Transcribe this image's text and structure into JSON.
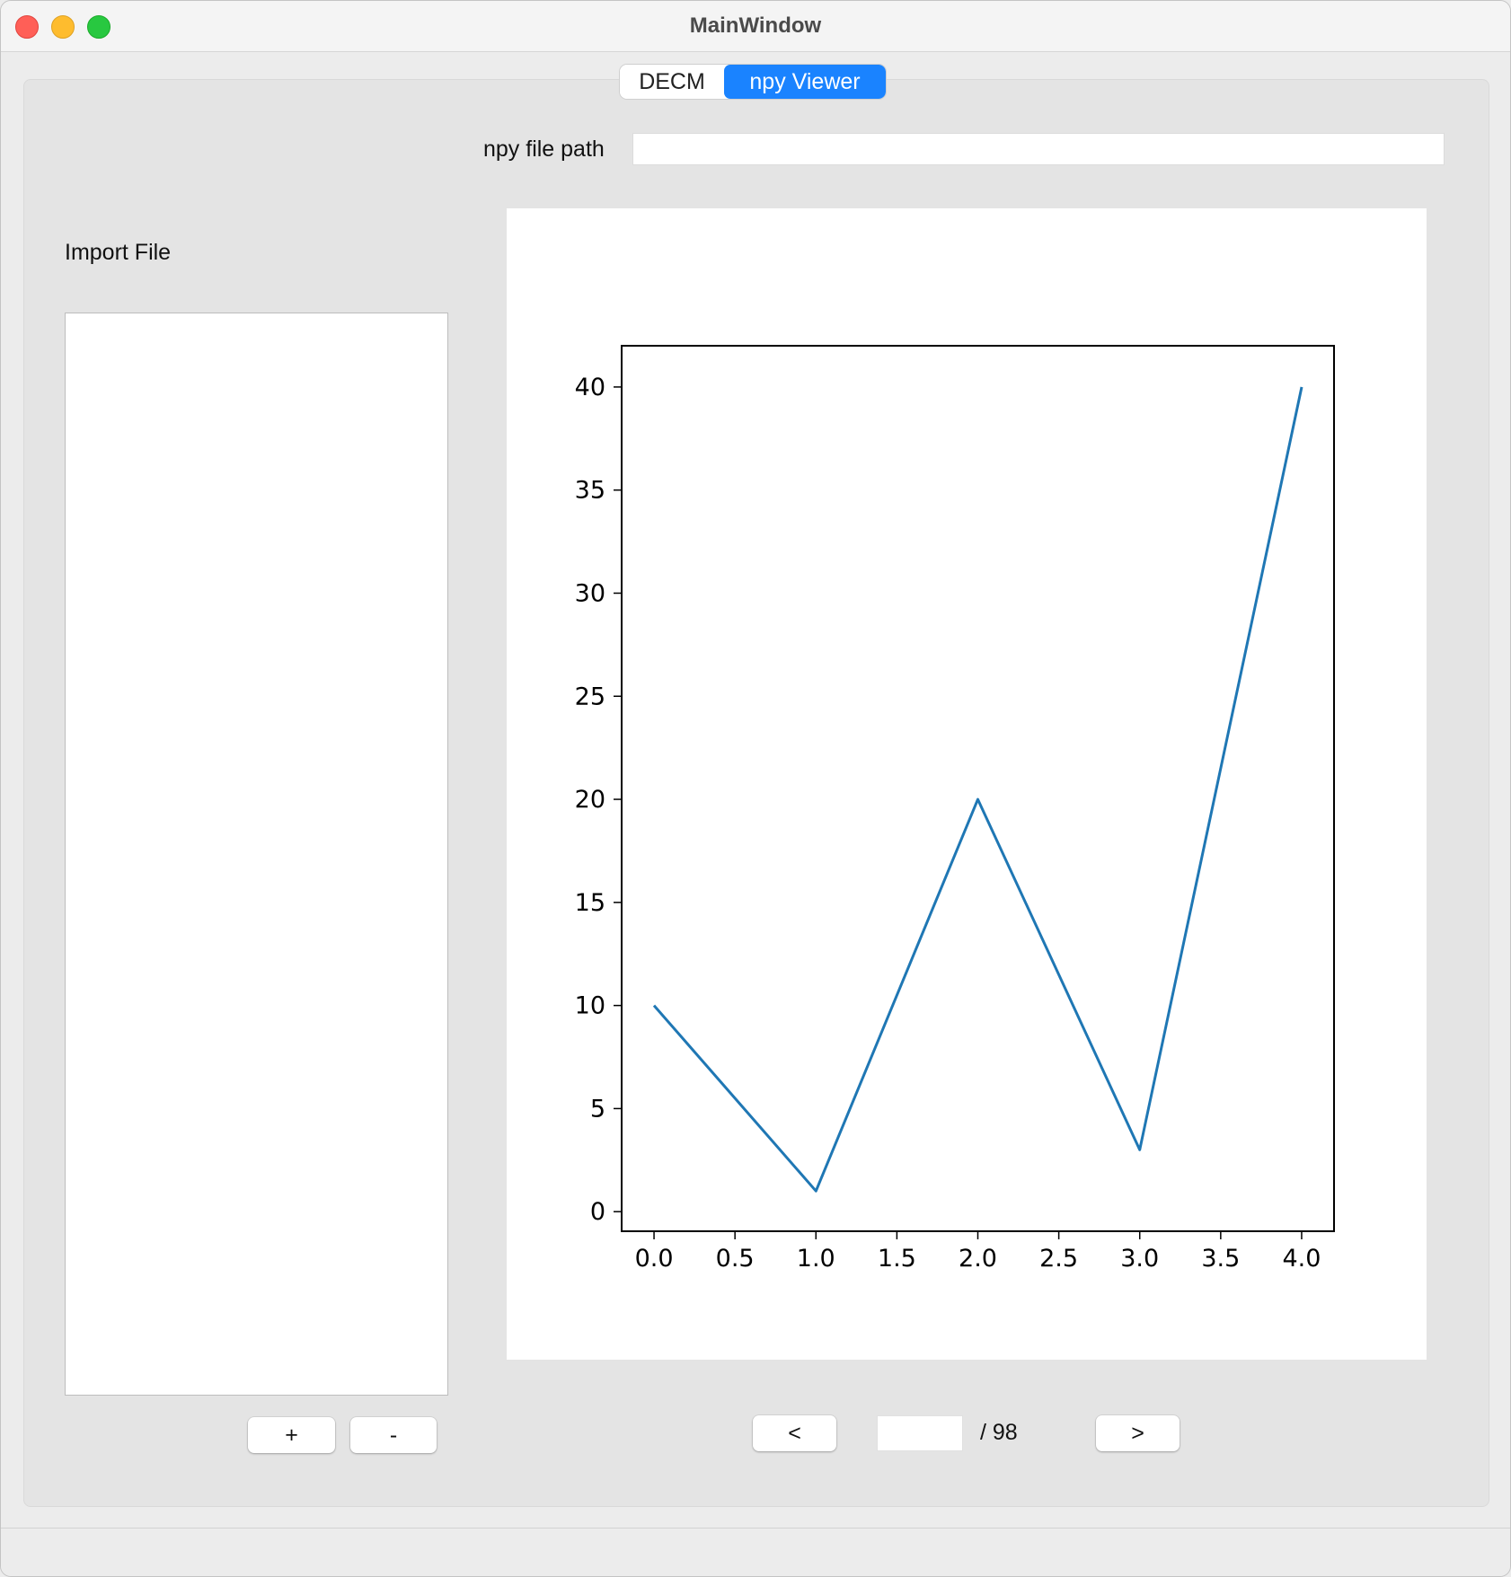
{
  "window": {
    "title": "MainWindow"
  },
  "tabs": [
    {
      "label": "DECM",
      "active": false
    },
    {
      "label": "npy Viewer",
      "active": true
    }
  ],
  "path": {
    "label": "npy file path",
    "value": ""
  },
  "import": {
    "label": "Import File",
    "add_label": "+",
    "remove_label": "-"
  },
  "pager": {
    "prev_label": "<",
    "next_label": ">",
    "current_value": "",
    "total_text": "/ 98"
  },
  "chart_data": {
    "type": "line",
    "x": [
      0,
      1,
      2,
      3,
      4
    ],
    "series": [
      {
        "values": [
          10,
          1,
          20,
          3,
          40
        ],
        "color": "#1f77b4"
      }
    ],
    "xlim": [
      -0.2,
      4.2
    ],
    "ylim": [
      -0.95,
      42
    ],
    "xticks": [
      "0.0",
      "0.5",
      "1.0",
      "1.5",
      "2.0",
      "2.5",
      "3.0",
      "3.5",
      "4.0"
    ],
    "yticks": [
      "0",
      "5",
      "10",
      "15",
      "20",
      "25",
      "30",
      "35",
      "40"
    ],
    "grid": false,
    "title": "",
    "xlabel": "",
    "ylabel": ""
  }
}
